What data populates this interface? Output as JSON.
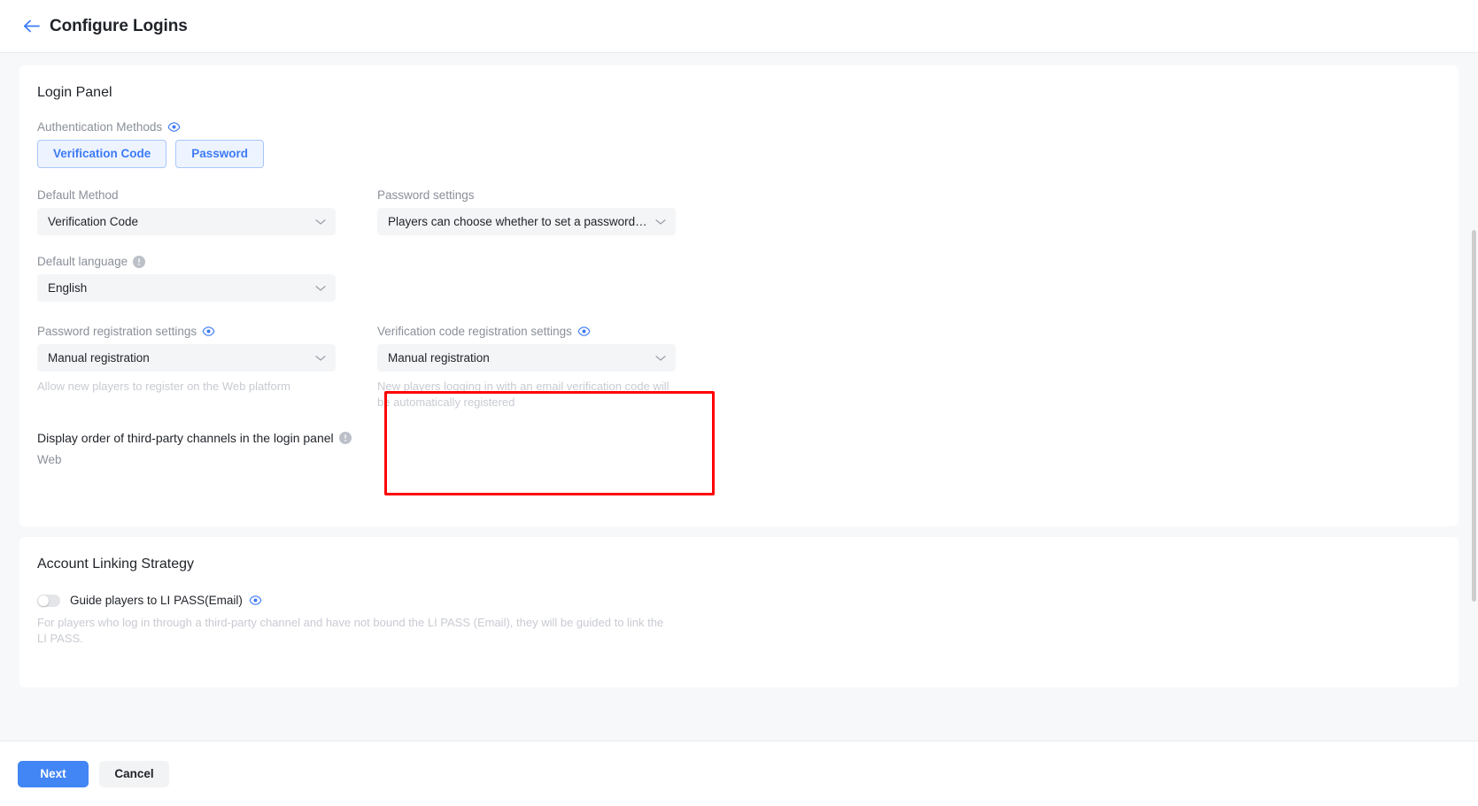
{
  "header": {
    "title": "Configure Logins",
    "back_icon": "arrow-left-icon"
  },
  "login_panel": {
    "title": "Login Panel",
    "auth_methods": {
      "label": "Authentication Methods",
      "eye_icon": "eye-icon",
      "chips": [
        {
          "label": "Verification Code"
        },
        {
          "label": "Password"
        }
      ]
    },
    "default_method": {
      "label": "Default Method",
      "value": "Verification Code"
    },
    "password_settings": {
      "label": "Password settings",
      "value": "Players can choose whether to set a password duri..."
    },
    "default_language": {
      "label": "Default language",
      "info_icon": "info-icon",
      "value": "English"
    },
    "password_registration": {
      "label": "Password registration settings",
      "eye_icon": "eye-icon",
      "value": "Manual registration",
      "helper": "Allow new players to register on the Web platform"
    },
    "verification_code_registration": {
      "label": "Verification code registration settings",
      "eye_icon": "eye-icon",
      "value": "Manual registration",
      "helper": "New players logging in with an email verification code will be automatically registered",
      "highlight_color": "#ff0000"
    },
    "third_party_order": {
      "label": "Display order of third-party channels in the login panel",
      "info_icon": "info-icon",
      "platform": "Web"
    }
  },
  "account_linking": {
    "title": "Account Linking Strategy",
    "toggle": {
      "label": "Guide players to LI PASS(Email)",
      "eye_icon": "eye-icon",
      "enabled": false
    },
    "description": "For players who log in through a third-party channel and have not bound the LI PASS (Email), they will be guided to link the LI PASS."
  },
  "footer": {
    "next_label": "Next",
    "cancel_label": "Cancel",
    "primary_color": "#4285f4"
  }
}
